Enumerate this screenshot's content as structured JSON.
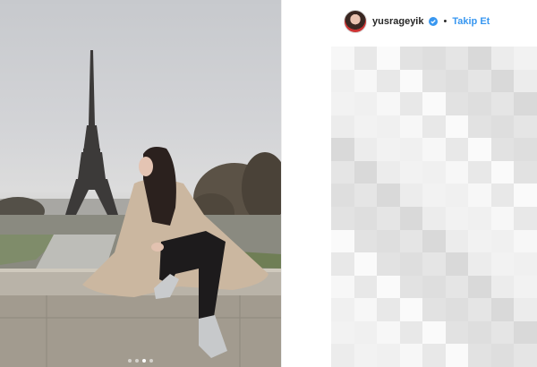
{
  "post": {
    "image_alt": "",
    "carousel": {
      "total": 4,
      "active": 3
    }
  },
  "header": {
    "username": "yusrageyik",
    "separator": "•",
    "follow_label": "Takip Et",
    "verified_icon": "verified-badge-icon"
  },
  "colors": {
    "link_blue": "#3897f0",
    "text_dark": "#262626",
    "divider": "#efefef"
  }
}
